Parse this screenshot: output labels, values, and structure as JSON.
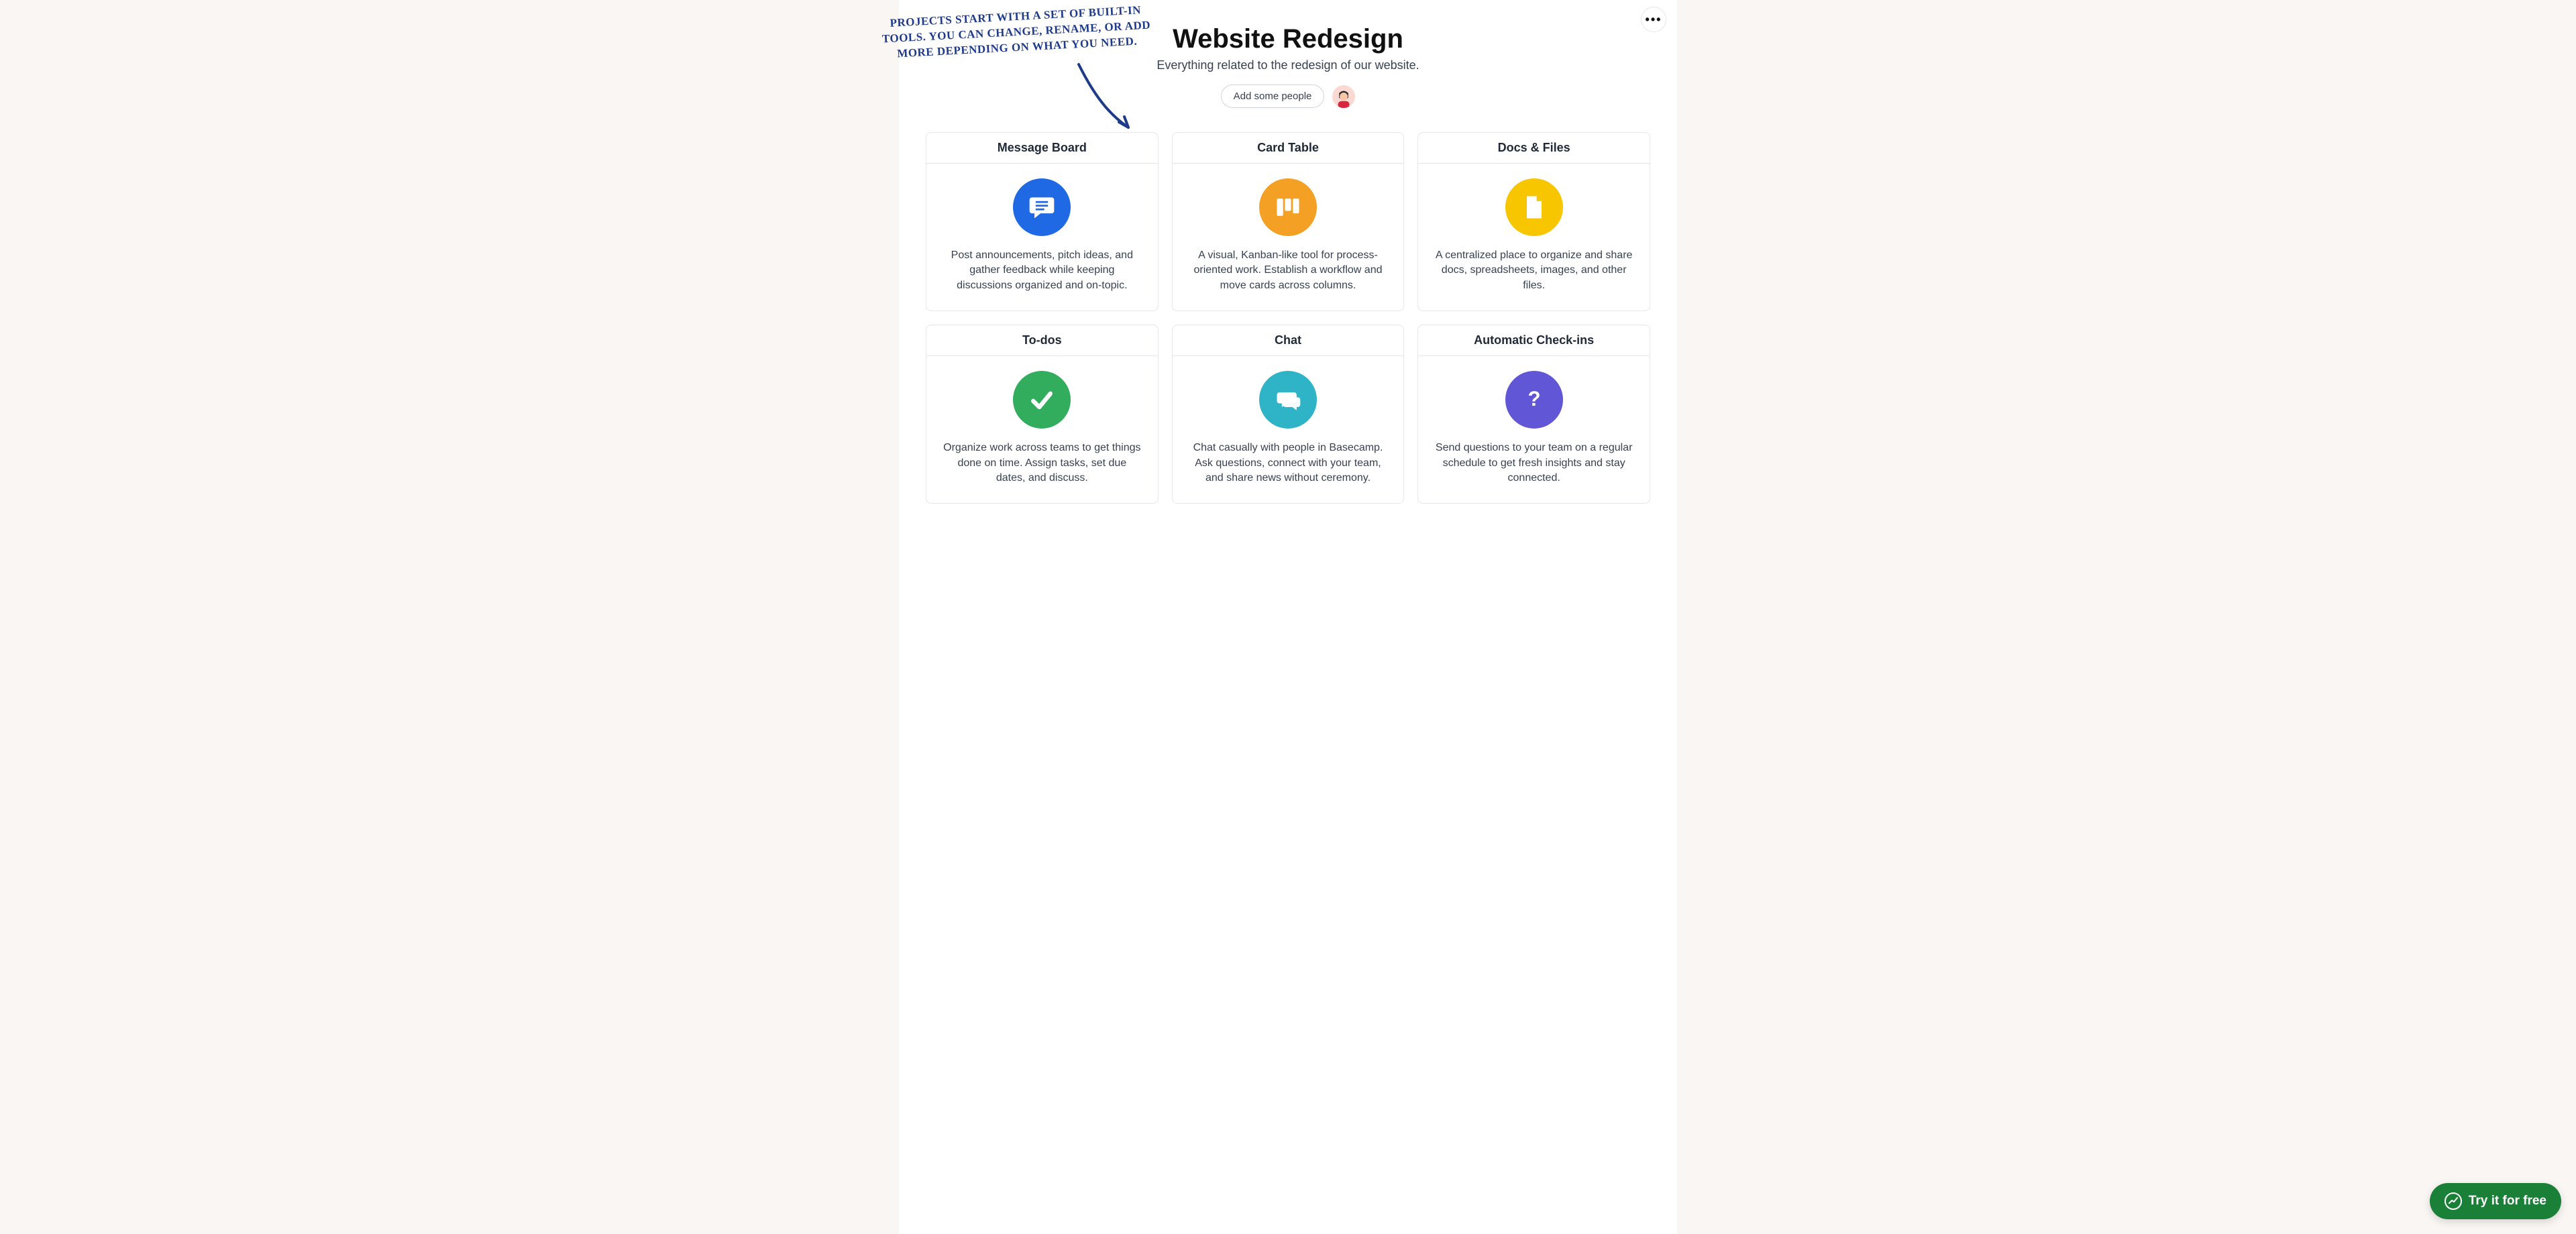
{
  "annotation": "Projects start with a set of built-in tools. You can change, rename, or add more depending on what you need.",
  "project": {
    "title": "Website Redesign",
    "subtitle": "Everything related to the redesign of our website.",
    "add_people_label": "Add some people"
  },
  "tools": [
    {
      "id": "message-board",
      "title": "Message Board",
      "icon_bg": "bg-navy",
      "desc": "Post announcements, pitch ideas, and gather feedback while keeping discussions organized and on-topic."
    },
    {
      "id": "card-table",
      "title": "Card Table",
      "icon_bg": "bg-orange",
      "desc": "A visual, Kanban-like tool for process-oriented work. Establish a workflow and move cards across columns."
    },
    {
      "id": "docs-files",
      "title": "Docs & Files",
      "icon_bg": "bg-gold",
      "desc": "A centralized place to organize and share docs, spreadsheets, images, and other files."
    },
    {
      "id": "to-dos",
      "title": "To-dos",
      "icon_bg": "bg-green",
      "desc": "Organize work across teams to get things done on time. Assign tasks, set due dates, and discuss."
    },
    {
      "id": "chat",
      "title": "Chat",
      "icon_bg": "bg-teal",
      "desc": "Chat casually with people in Basecamp. Ask questions, connect with your team, and share news without ceremony."
    },
    {
      "id": "auto-checkins",
      "title": "Automatic Check-ins",
      "icon_bg": "bg-purple",
      "desc": "Send questions to your team on a regular schedule to get fresh insights and stay connected."
    }
  ],
  "cta": {
    "label": "Try it for free"
  }
}
